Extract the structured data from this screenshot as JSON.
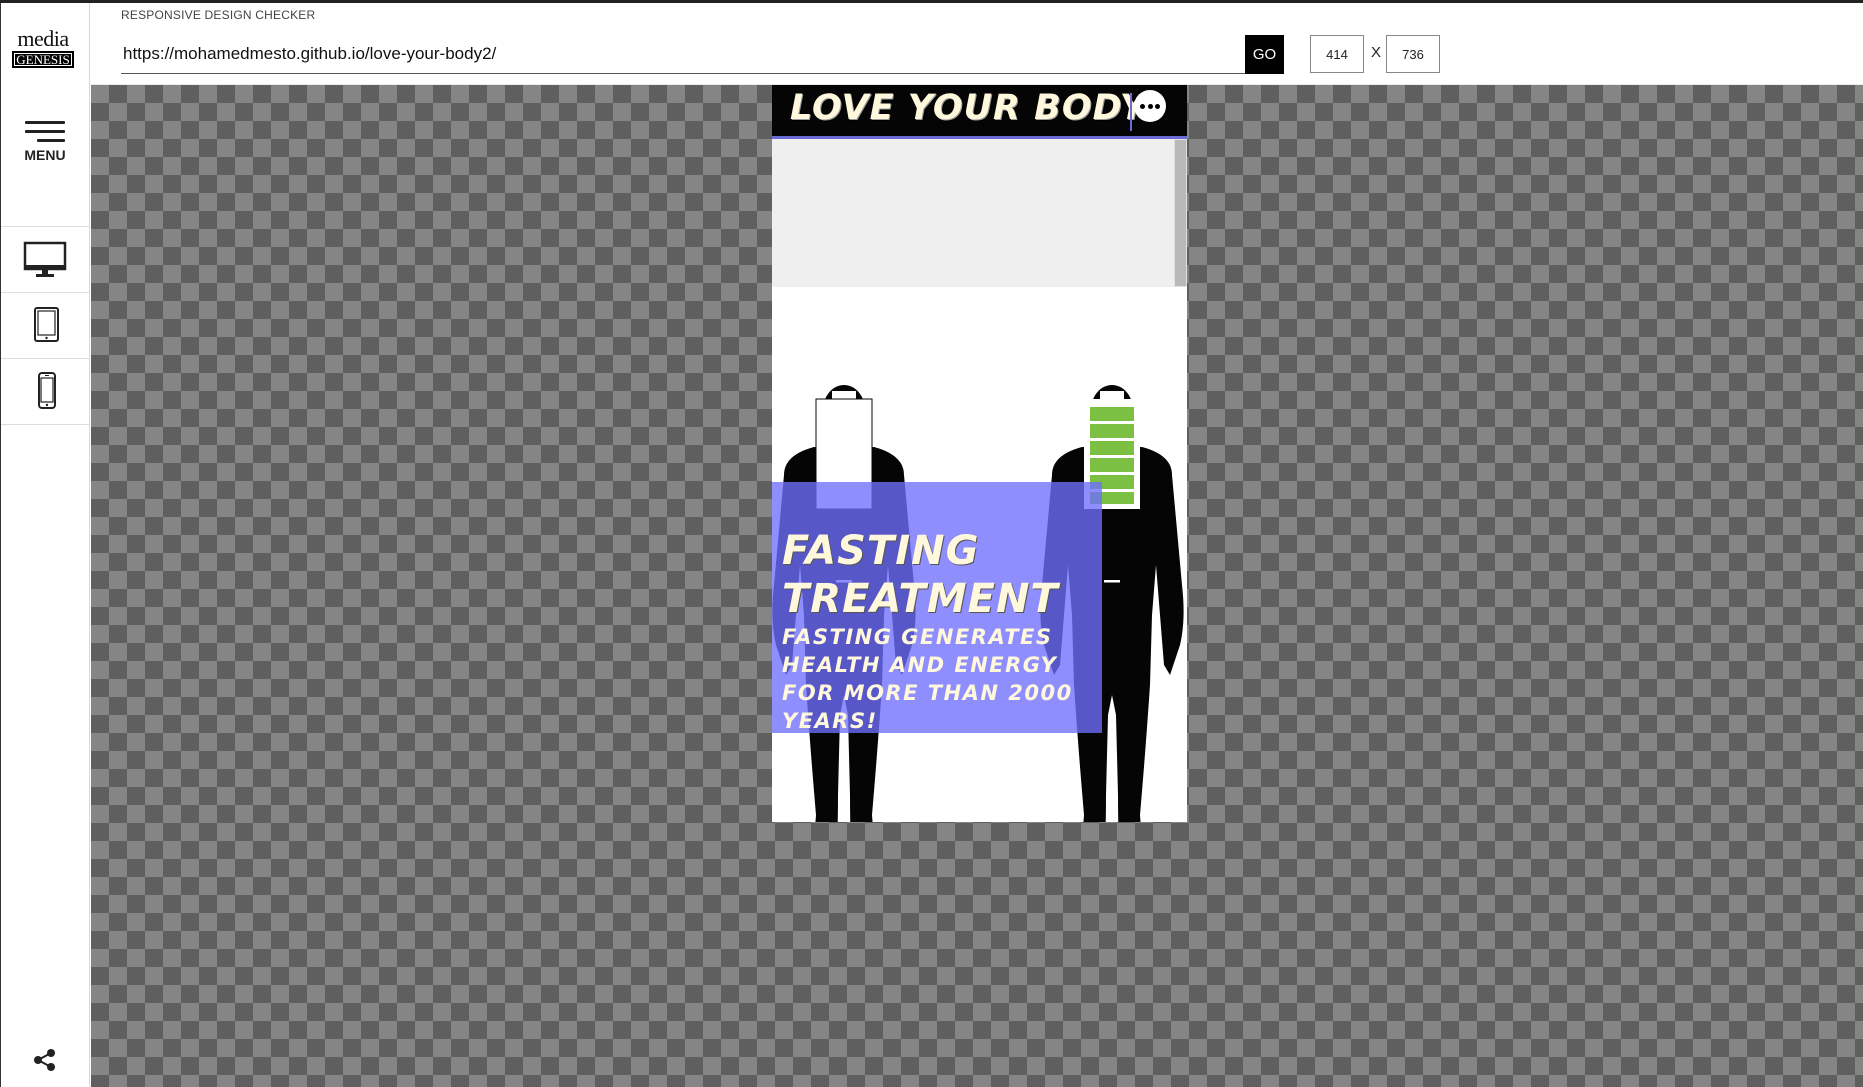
{
  "app": {
    "title": "RESPONSIVE DESIGN CHECKER",
    "logo_top": "media",
    "logo_bottom": "GENESIS",
    "menu_label": "MENU"
  },
  "devices": [
    {
      "name": "desktop",
      "icon": "monitor-icon"
    },
    {
      "name": "tablet",
      "icon": "tablet-icon"
    },
    {
      "name": "phone",
      "icon": "phone-icon"
    }
  ],
  "toolbar": {
    "url": "https://mohamedmesto.github.io/love-your-body2/",
    "go_label": "GO",
    "width": "414",
    "separator": "X",
    "height": "736"
  },
  "site": {
    "header_title": "LOVE YOUR BODY!",
    "hero_title_line1": "FASTING",
    "hero_title_line2": "TREATMENT",
    "hero_subtitle": "FASTING GENERATES HEALTH AND ENERGY FOR MORE THAN 2000 YEARS!",
    "battery_left_level": 0,
    "battery_right_level": 1,
    "battery_color": "#7bc043",
    "overlay_color": "#6e6eff",
    "accent_color": "#6b6bd8"
  }
}
